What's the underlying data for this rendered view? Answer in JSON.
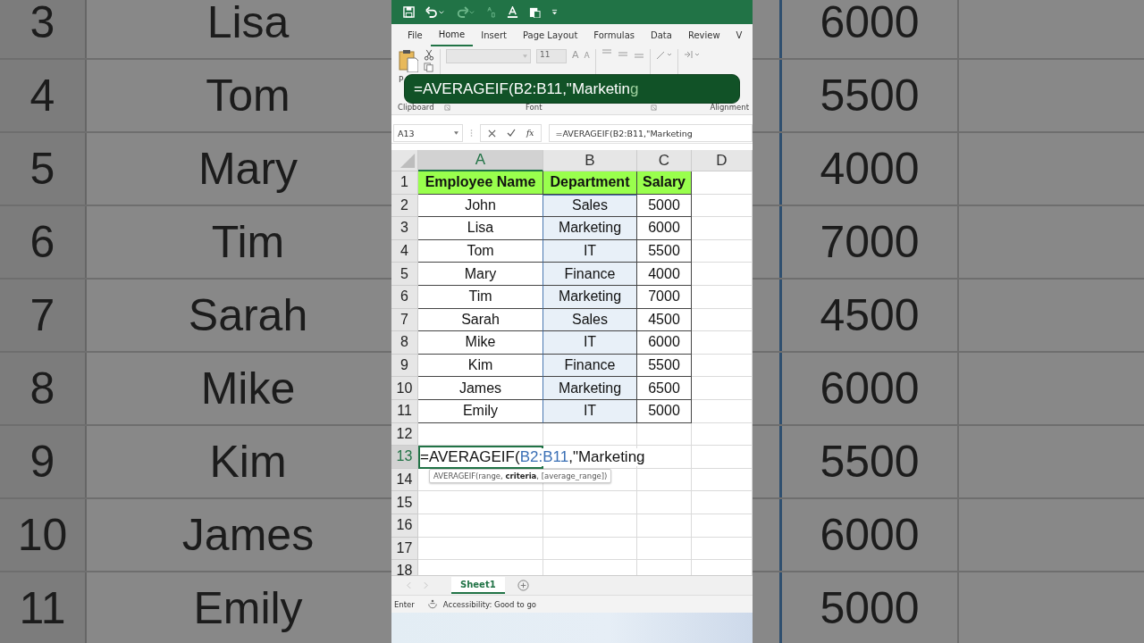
{
  "backdrop_left": {
    "rows": [
      {
        "row": "3",
        "name": "Lisa"
      },
      {
        "row": "4",
        "name": "Tom"
      },
      {
        "row": "5",
        "name": "Mary"
      },
      {
        "row": "6",
        "name": "Tim"
      },
      {
        "row": "7",
        "name": "Sarah"
      },
      {
        "row": "8",
        "name": "Mike"
      },
      {
        "row": "9",
        "name": "Kim"
      },
      {
        "row": "10",
        "name": "James"
      },
      {
        "row": "11",
        "name": "Emily"
      }
    ]
  },
  "backdrop_right": {
    "values": [
      "6000",
      "5500",
      "4000",
      "7000",
      "4500",
      "6000",
      "5500",
      "6000",
      "5000"
    ]
  },
  "ribbon": {
    "tabs": [
      {
        "label": "File",
        "selected": false
      },
      {
        "label": "Home",
        "selected": true
      },
      {
        "label": "Insert",
        "selected": false
      },
      {
        "label": "Page Layout",
        "selected": false
      },
      {
        "label": "Formulas",
        "selected": false
      },
      {
        "label": "Data",
        "selected": false
      },
      {
        "label": "Review",
        "selected": false
      },
      {
        "label": "V",
        "selected": false
      }
    ],
    "paste_label": "P",
    "font_size": "11",
    "grow_font": "A",
    "shrink_font": "A",
    "groups": [
      "Clipboard",
      "Font",
      "Alignment"
    ]
  },
  "caption": {
    "text": "=AVERAGEIF(B2:B11,\"Marketin",
    "pending": "g"
  },
  "formula_bar": {
    "name_box": "A13",
    "fx_label": "fx",
    "formula": "=AVERAGEIF(B2:B11,\"Marketing"
  },
  "sheet": {
    "columns": [
      {
        "label": "A",
        "selected": true
      },
      {
        "label": "B",
        "selected": false
      },
      {
        "label": "C",
        "selected": false
      },
      {
        "label": "D",
        "selected": false
      }
    ],
    "rows": [
      {
        "kind": "header",
        "row": "1",
        "cells": [
          "Employee Name",
          "Department",
          "Salary"
        ]
      },
      {
        "kind": "data",
        "row": "2",
        "cells": [
          "John",
          "Sales",
          "5000"
        ],
        "in_range": true
      },
      {
        "kind": "data",
        "row": "3",
        "cells": [
          "Lisa",
          "Marketing",
          "6000"
        ],
        "in_range": true
      },
      {
        "kind": "data",
        "row": "4",
        "cells": [
          "Tom",
          "IT",
          "5500"
        ],
        "in_range": true
      },
      {
        "kind": "data",
        "row": "5",
        "cells": [
          "Mary",
          "Finance",
          "4000"
        ],
        "in_range": true
      },
      {
        "kind": "data",
        "row": "6",
        "cells": [
          "Tim",
          "Marketing",
          "7000"
        ],
        "in_range": true
      },
      {
        "kind": "data",
        "row": "7",
        "cells": [
          "Sarah",
          "Sales",
          "4500"
        ],
        "in_range": true
      },
      {
        "kind": "data",
        "row": "8",
        "cells": [
          "Mike",
          "IT",
          "6000"
        ],
        "in_range": true
      },
      {
        "kind": "data",
        "row": "9",
        "cells": [
          "Kim",
          "Finance",
          "5500"
        ],
        "in_range": true
      },
      {
        "kind": "data",
        "row": "10",
        "cells": [
          "James",
          "Marketing",
          "6500"
        ],
        "in_range": true
      },
      {
        "kind": "data",
        "row": "11",
        "cells": [
          "Emily",
          "IT",
          "5000"
        ],
        "in_range": true
      },
      {
        "kind": "empty",
        "row": "12"
      },
      {
        "kind": "editing",
        "row": "13",
        "prefix": "=AVERAGEIF(",
        "ref": "B2:B11",
        "suffix": ",\"Marketing",
        "tooltip": "AVERAGEIF(range, **criteria**, [average_range])"
      },
      {
        "kind": "empty",
        "row": "14"
      },
      {
        "kind": "empty",
        "row": "15"
      },
      {
        "kind": "empty",
        "row": "16"
      },
      {
        "kind": "empty",
        "row": "17"
      },
      {
        "kind": "empty",
        "row": "18"
      }
    ]
  },
  "sheet_tabs": [
    {
      "label": "Sheet1",
      "selected": true
    }
  ],
  "status_bar": {
    "mode": "Enter",
    "accessibility": "Accessibility: Good to go"
  }
}
